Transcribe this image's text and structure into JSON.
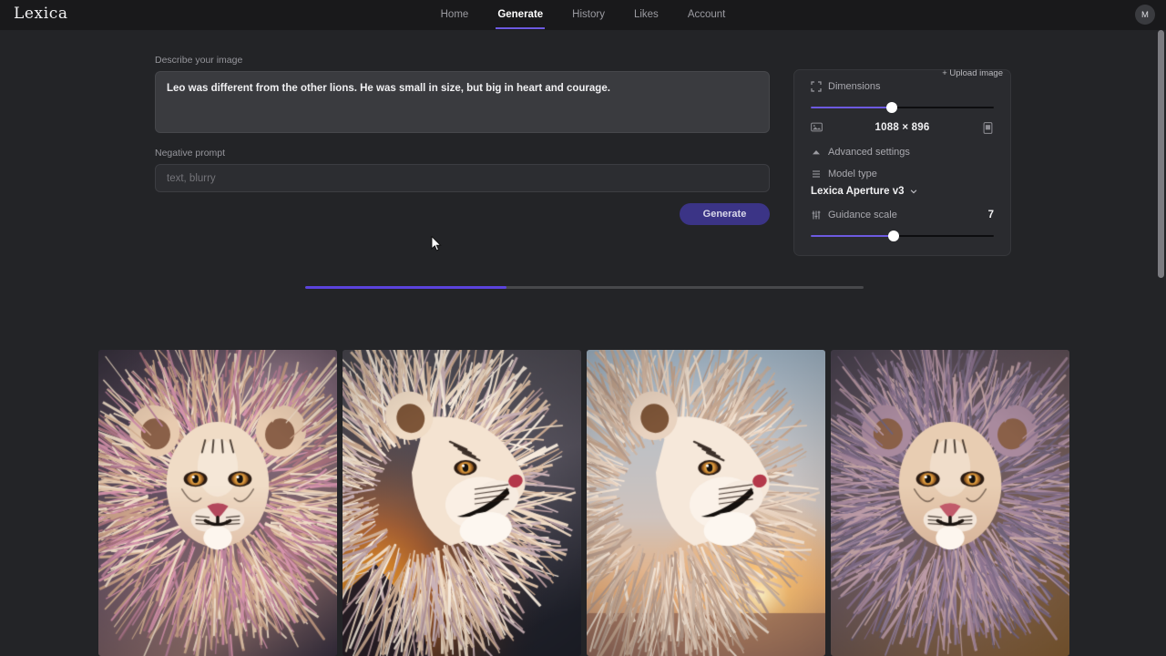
{
  "app": {
    "brand": "Lexica"
  },
  "nav": {
    "items": [
      {
        "label": "Home",
        "active": false
      },
      {
        "label": "Generate",
        "active": true
      },
      {
        "label": "History",
        "active": false
      },
      {
        "label": "Likes",
        "active": false
      },
      {
        "label": "Account",
        "active": false
      }
    ],
    "avatar_initial": "M"
  },
  "form": {
    "prompt_label": "Describe your image",
    "prompt_value": "Leo was different from the other lions. He was small in size, but big in heart and courage.",
    "prompt_placeholder": "Describe your image",
    "negative_label": "Negative prompt",
    "negative_value": "",
    "negative_placeholder": "text, blurry",
    "generate_label": "Generate"
  },
  "settings": {
    "upload_label": "+ Upload image",
    "dimensions_label": "Dimensions",
    "dimensions_icon": "expand-corners-icon",
    "dimensions_value": "1088 × 896",
    "dimensions_slider_percent": 44,
    "landscape_icon": "landscape-image-icon",
    "portrait_icon": "portrait-image-icon",
    "advanced_label": "Advanced settings",
    "advanced_icon": "caret-up-icon",
    "model_type_label": "Model type",
    "model_type_icon": "list-icon",
    "model_name": "Lexica Aperture v3",
    "model_chevron_icon": "chevron-down-icon",
    "guidance_label": "Guidance scale",
    "guidance_icon": "sliders-icon",
    "guidance_value": "7",
    "guidance_slider_percent": 45
  },
  "progress": {
    "percent": 36
  },
  "results": {
    "images": [
      {
        "alt": "front-facing lion with cream and pink mane on purple nebula background",
        "seed": 11
      },
      {
        "alt": "lion profile facing right with fiery orange mountain landscape",
        "seed": 27
      },
      {
        "alt": "lion profile facing right over savanna sunset",
        "seed": 43
      },
      {
        "alt": "front-facing lion with purple mauve mane",
        "seed": 58
      }
    ]
  },
  "colors": {
    "accent": "#6d5ae0",
    "progress_fill": "#5b43dd",
    "page_bg": "#232427",
    "nav_bg": "#19191b",
    "panel_bg": "#2a2b2f",
    "button_bg": "#3b3486"
  }
}
